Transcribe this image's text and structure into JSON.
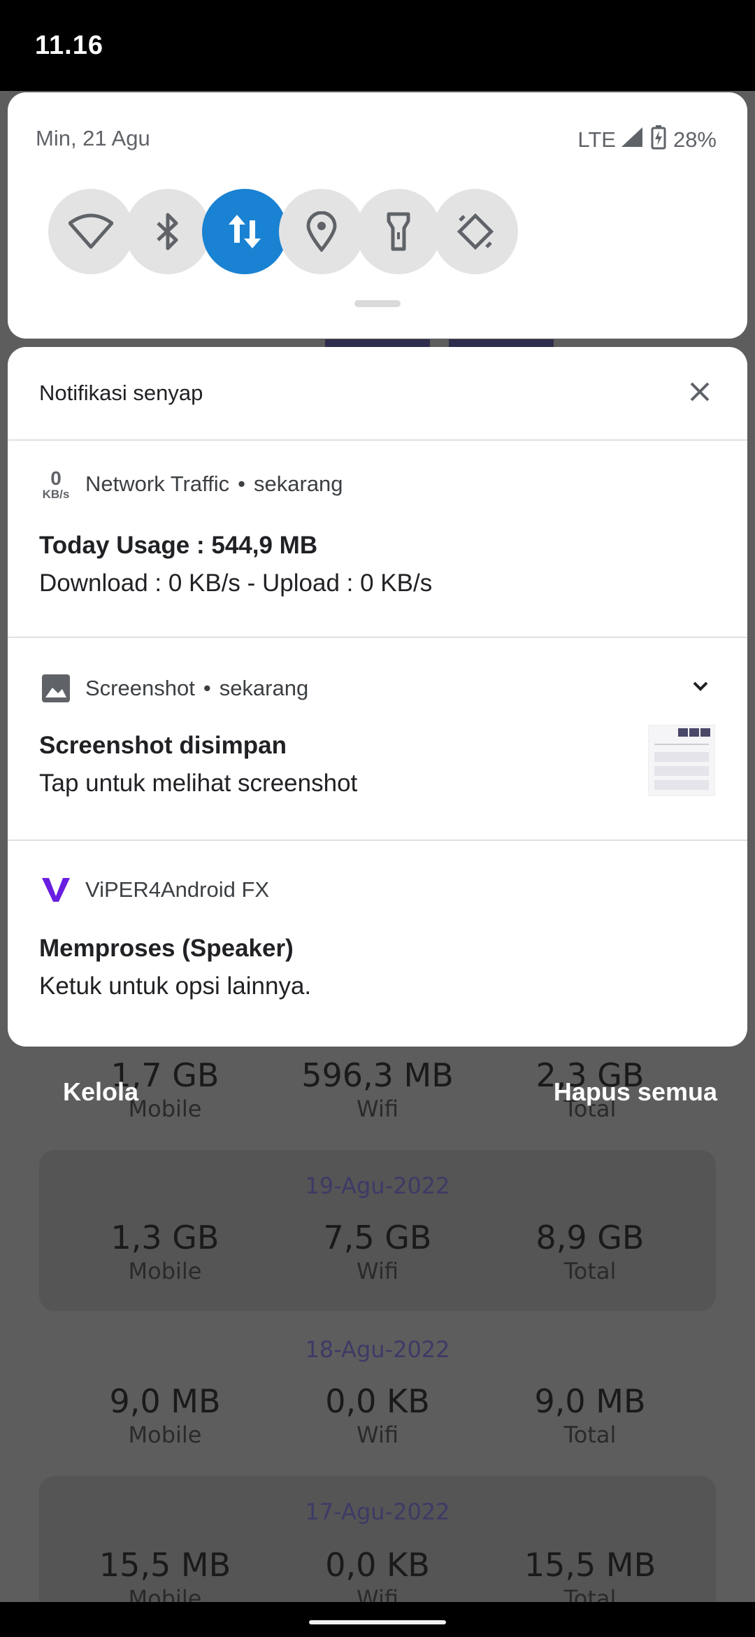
{
  "status_bar": {
    "time": "11.16"
  },
  "quick_settings": {
    "date": "Min, 21 Agu",
    "network": "LTE",
    "battery": "28%",
    "tiles": [
      {
        "icon": "wifi-icon",
        "active": false
      },
      {
        "icon": "bluetooth-icon",
        "active": false
      },
      {
        "icon": "mobile-data-icon",
        "active": true
      },
      {
        "icon": "location-icon",
        "active": false
      },
      {
        "icon": "flashlight-icon",
        "active": false
      },
      {
        "icon": "auto-rotate-icon",
        "active": false
      }
    ],
    "active_color": "#1a82d2"
  },
  "notifications": {
    "header": "Notifikasi senyap",
    "items": [
      {
        "badge_value": "0",
        "badge_unit": "KB/s",
        "app": "Network Traffic",
        "time": "sekarang",
        "title": "Today Usage : 544,9 MB",
        "body": "Download : 0 KB/s  -  Upload : 0 KB/s"
      },
      {
        "app": "Screenshot",
        "time": "sekarang",
        "title": "Screenshot disimpan",
        "body": "Tap untuk melihat screenshot"
      },
      {
        "app": "ViPER4Android FX",
        "title": "Memproses (Speaker)",
        "body": "Ketuk untuk opsi lainnya."
      }
    ]
  },
  "footer": {
    "manage": "Kelola",
    "clear_all": "Hapus semua"
  },
  "background_app": {
    "rows": [
      {
        "date": "",
        "mobile": "1,7 GB",
        "wifi": "596,3 MB",
        "total": "2,3 GB"
      },
      {
        "date": "19-Agu-2022",
        "mobile": "1,3 GB",
        "wifi": "7,5 GB",
        "total": "8,9 GB"
      },
      {
        "date": "18-Agu-2022",
        "mobile": "9,0 MB",
        "wifi": "0,0 KB",
        "total": "9,0 MB"
      },
      {
        "date": "17-Agu-2022",
        "mobile": "15,5 MB",
        "wifi": "0,0 KB",
        "total": "15,5 MB"
      }
    ],
    "labels": {
      "mobile": "Mobile",
      "wifi": "Wifi",
      "total": "Total"
    }
  }
}
